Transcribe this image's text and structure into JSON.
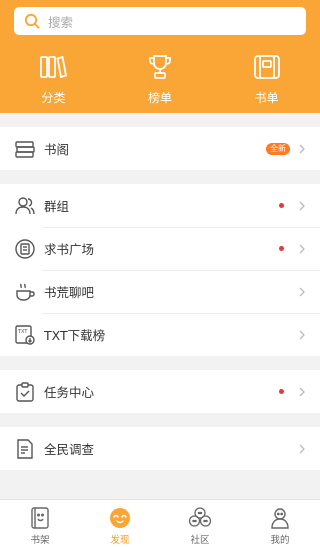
{
  "search": {
    "placeholder": "搜索"
  },
  "categories": [
    {
      "label": "分类",
      "icon": "books-icon"
    },
    {
      "label": "榜单",
      "icon": "trophy-icon"
    },
    {
      "label": "书单",
      "icon": "booklist-icon"
    }
  ],
  "menu": {
    "shuge": {
      "label": "书阁",
      "badge": "全新"
    },
    "qunzu": {
      "label": "群组",
      "has_dot": true
    },
    "qiushu": {
      "label": "求书广场",
      "has_dot": true
    },
    "shuhuang": {
      "label": "书荒聊吧"
    },
    "txt": {
      "label": "TXT下载榜"
    },
    "renwu": {
      "label": "任务中心",
      "has_dot": true
    },
    "diaocha": {
      "label": "全民调查"
    }
  },
  "tabbar": {
    "items": [
      {
        "label": "书架",
        "icon": "bookshelf-icon"
      },
      {
        "label": "发现",
        "icon": "discover-icon",
        "active": true
      },
      {
        "label": "社区",
        "icon": "community-icon"
      },
      {
        "label": "我的",
        "icon": "profile-icon"
      }
    ]
  },
  "colors": {
    "accent": "#f9a637",
    "dot": "#e23a3a",
    "badge": "#ff7a22",
    "active_tab": "#f39b1e"
  }
}
